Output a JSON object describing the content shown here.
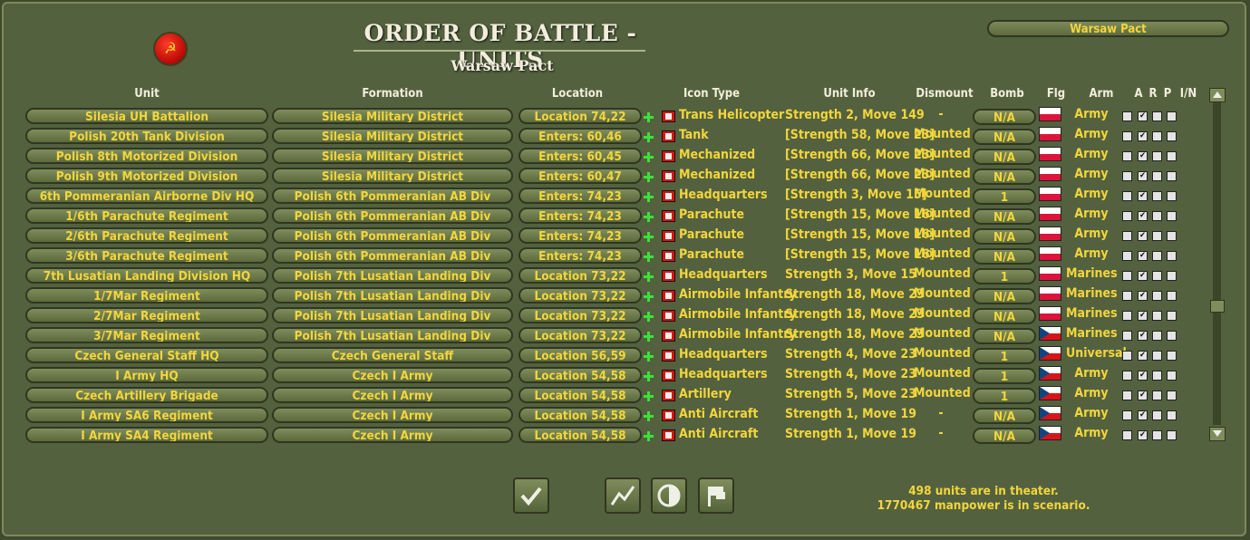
{
  "title": "ORDER OF BATTLE - UNITS",
  "subtitle": "Warsaw Pact",
  "side_button": "Warsaw Pact",
  "emblem_glyph": "☭",
  "headers": {
    "unit": "Unit",
    "formation": "Formation",
    "location": "Location",
    "icon_type": "Icon Type",
    "unit_info": "Unit Info",
    "dismount": "Dismount",
    "bomb": "Bomb",
    "flg": "Flg",
    "arm": "Arm",
    "a": "A",
    "r": "R",
    "p": "P",
    "in": "I/N"
  },
  "rows": [
    {
      "unit": "Silesia UH Battalion",
      "formation": "Silesia Military District",
      "location": "Location 74,22",
      "icon_type": "Trans Helicopter",
      "info": "Strength 2, Move 149",
      "dismount": "-",
      "bomb": "N/A",
      "flag": "pl",
      "arm": "Army",
      "a": false,
      "r": true,
      "p": false,
      "in": false
    },
    {
      "unit": "Polish 20th Tank Division",
      "formation": "Silesia Military District",
      "location": "Enters: 60,46",
      "icon_type": "Tank",
      "info": "[Strength 58, Move 23]",
      "dismount": "Mounted",
      "bomb": "N/A",
      "flag": "pl",
      "arm": "Army",
      "a": false,
      "r": true,
      "p": false,
      "in": false
    },
    {
      "unit": "Polish 8th Motorized Division",
      "formation": "Silesia Military District",
      "location": "Enters: 60,45",
      "icon_type": "Mechanized",
      "info": "[Strength 66, Move 23]",
      "dismount": "Mounted",
      "bomb": "N/A",
      "flag": "pl",
      "arm": "Army",
      "a": false,
      "r": true,
      "p": false,
      "in": false
    },
    {
      "unit": "Polish 9th Motorized Division",
      "formation": "Silesia Military District",
      "location": "Enters: 60,47",
      "icon_type": "Mechanized",
      "info": "[Strength 66, Move 23]",
      "dismount": "Mounted",
      "bomb": "N/A",
      "flag": "pl",
      "arm": "Army",
      "a": false,
      "r": true,
      "p": false,
      "in": false
    },
    {
      "unit": "6th Pommeranian Airborne Div HQ",
      "formation": "Polish 6th Pommeranian AB Div",
      "location": "Enters: 74,23",
      "icon_type": "Headquarters",
      "info": "[Strength 3, Move 15]",
      "dismount": "Mounted",
      "bomb": "1",
      "flag": "pl",
      "arm": "Army",
      "a": false,
      "r": true,
      "p": false,
      "in": false
    },
    {
      "unit": "1/6th Parachute Regiment",
      "formation": "Polish 6th Pommeranian AB Div",
      "location": "Enters: 74,23",
      "icon_type": "Parachute",
      "info": "[Strength 15, Move 16]",
      "dismount": "Mounted",
      "bomb": "N/A",
      "flag": "pl",
      "arm": "Army",
      "a": false,
      "r": true,
      "p": false,
      "in": false
    },
    {
      "unit": "2/6th Parachute Regiment",
      "formation": "Polish 6th Pommeranian AB Div",
      "location": "Enters: 74,23",
      "icon_type": "Parachute",
      "info": "[Strength 15, Move 16]",
      "dismount": "Mounted",
      "bomb": "N/A",
      "flag": "pl",
      "arm": "Army",
      "a": false,
      "r": true,
      "p": false,
      "in": false
    },
    {
      "unit": "3/6th Parachute Regiment",
      "formation": "Polish 6th Pommeranian AB Div",
      "location": "Enters: 74,23",
      "icon_type": "Parachute",
      "info": "[Strength 15, Move 16]",
      "dismount": "Mounted",
      "bomb": "N/A",
      "flag": "pl",
      "arm": "Army",
      "a": false,
      "r": true,
      "p": false,
      "in": false
    },
    {
      "unit": "7th Lusatian Landing Division HQ",
      "formation": "Polish 7th Lusatian Landing Div",
      "location": "Location 73,22",
      "icon_type": "Headquarters",
      "info": "Strength 3, Move 15",
      "dismount": "Mounted",
      "bomb": "1",
      "flag": "pl",
      "arm": "Marines",
      "a": false,
      "r": true,
      "p": false,
      "in": false
    },
    {
      "unit": "1/7Mar Regiment",
      "formation": "Polish 7th Lusatian Landing Div",
      "location": "Location 73,22",
      "icon_type": "Airmobile Infantry",
      "info": "Strength 18, Move 23",
      "dismount": "Mounted",
      "bomb": "N/A",
      "flag": "pl",
      "arm": "Marines",
      "a": false,
      "r": true,
      "p": false,
      "in": false
    },
    {
      "unit": "2/7Mar Regiment",
      "formation": "Polish 7th Lusatian Landing Div",
      "location": "Location 73,22",
      "icon_type": "Airmobile Infantry",
      "info": "Strength 18, Move 23",
      "dismount": "Mounted",
      "bomb": "N/A",
      "flag": "pl",
      "arm": "Marines",
      "a": false,
      "r": true,
      "p": false,
      "in": false
    },
    {
      "unit": "3/7Mar Regiment",
      "formation": "Polish 7th Lusatian Landing Div",
      "location": "Location 73,22",
      "icon_type": "Airmobile Infantry",
      "info": "Strength 18, Move 23",
      "dismount": "Mounted",
      "bomb": "N/A",
      "flag": "cz",
      "arm": "Marines",
      "a": false,
      "r": true,
      "p": false,
      "in": false
    },
    {
      "unit": "Czech General Staff HQ",
      "formation": "Czech General Staff",
      "location": "Location 56,59",
      "icon_type": "Headquarters",
      "info": "Strength 4, Move 23",
      "dismount": "Mounted",
      "bomb": "1",
      "flag": "cz",
      "arm": "Universal",
      "a": false,
      "r": true,
      "p": false,
      "in": false
    },
    {
      "unit": "I Army HQ",
      "formation": "Czech I Army",
      "location": "Location 54,58",
      "icon_type": "Headquarters",
      "info": "Strength 4, Move 23",
      "dismount": "Mounted",
      "bomb": "1",
      "flag": "cz",
      "arm": "Army",
      "a": false,
      "r": true,
      "p": false,
      "in": false
    },
    {
      "unit": "Czech Artillery Brigade",
      "formation": "Czech I Army",
      "location": "Location 54,58",
      "icon_type": "Artillery",
      "info": "Strength 5, Move 23",
      "dismount": "Mounted",
      "bomb": "1",
      "flag": "cz",
      "arm": "Army",
      "a": false,
      "r": true,
      "p": false,
      "in": false
    },
    {
      "unit": "I Army SA6 Regiment",
      "formation": "Czech I Army",
      "location": "Location 54,58",
      "icon_type": "Anti Aircraft",
      "info": "Strength 1, Move 19",
      "dismount": "-",
      "bomb": "N/A",
      "flag": "cz",
      "arm": "Army",
      "a": false,
      "r": true,
      "p": false,
      "in": false
    },
    {
      "unit": "I Army SA4 Regiment",
      "formation": "Czech I Army",
      "location": "Location 54,58",
      "icon_type": "Anti Aircraft",
      "info": "Strength 1, Move 19",
      "dismount": "-",
      "bomb": "N/A",
      "flag": "cz",
      "arm": "Army",
      "a": false,
      "r": true,
      "p": false,
      "in": false
    }
  ],
  "buttons": [
    {
      "name": "confirm-button",
      "icon": "check-icon"
    },
    {
      "name": "chart-button",
      "icon": "line-chart-icon"
    },
    {
      "name": "contrast-button",
      "icon": "contrast-icon"
    },
    {
      "name": "flag-button",
      "icon": "flag-icon"
    }
  ],
  "footer": {
    "units_text": "498 units are in theater.",
    "manpower_text": "1770467 manpower is in scenario."
  },
  "colors": {
    "panel": "#53613f",
    "text": "#f3d63c",
    "header": "#f2eedb",
    "poland_red": "#dc143c",
    "czech_blue": "#11457e"
  }
}
